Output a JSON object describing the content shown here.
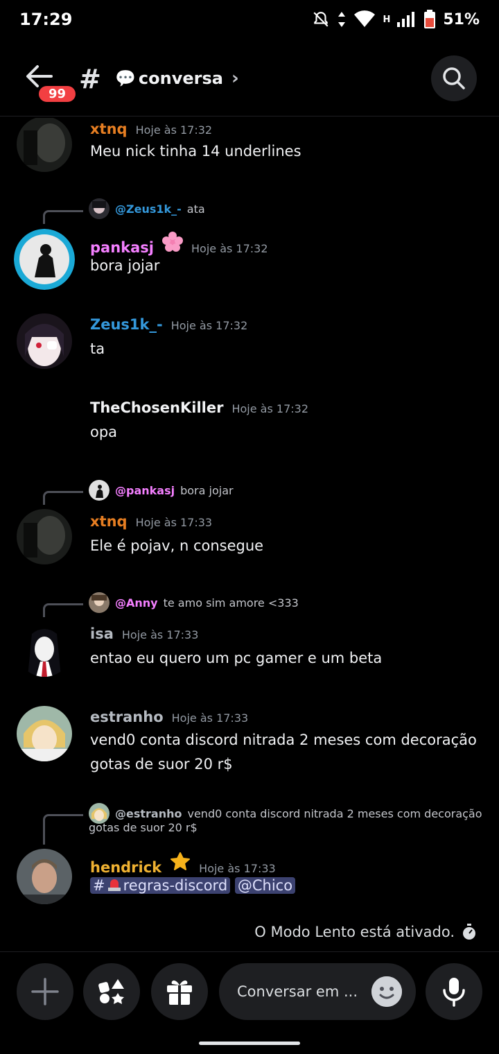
{
  "status_bar": {
    "time": "17:29",
    "network": "H",
    "battery": "51%"
  },
  "header": {
    "badge_count": "99",
    "channel_emoji": "💬",
    "channel_name": "conversa",
    "chevron": "›",
    "icons": [
      "back-arrow-icon",
      "hash-icon",
      "search-icon"
    ]
  },
  "colors": {
    "background": "#000000",
    "orange": "#e67e22",
    "pink": "#f47fff",
    "blue": "#3498db",
    "gold": "#f0b232",
    "gray_name": "#b5bac1",
    "mention_bg": "#3c4270"
  },
  "messages": [
    {
      "author": "xtnq",
      "time": "Hoje às 17:32",
      "text": "Meu nick tinha 14 underlines"
    },
    {
      "reply_to": "@Zeus1k_-",
      "reply_text": "ata",
      "author": "pankasj",
      "time": "Hoje às 17:32",
      "text": "bora jojar"
    },
    {
      "author": "Zeus1k_-",
      "time": "Hoje às 17:32",
      "text": "ta"
    },
    {
      "author": "TheChosenKiller",
      "time": "Hoje às 17:32",
      "text": "opa"
    },
    {
      "reply_to": "@pankasj",
      "reply_text": "bora jojar",
      "author": "xtnq",
      "time": "Hoje às 17:33",
      "text": "Ele é pojav, n consegue"
    },
    {
      "reply_to": "@Anny",
      "reply_text": "te amo sim amore <333",
      "author": "isa",
      "time": "Hoje às 17:33",
      "text": "entao eu quero um pc gamer e um beta"
    },
    {
      "author": "estranho",
      "time": "Hoje às 17:33",
      "text_line1": "vend0 conta discord nitrada 2 meses com decoração",
      "text_line2": "gotas de suor 20 r$"
    },
    {
      "reply_to": "@estranho",
      "reply_text_line1": "vend0 conta discord nitrada 2 meses com decoração",
      "reply_text_line2": "gotas de suor 20 r$",
      "author": "hendrick",
      "time": "Hoje às 17:33",
      "channel_mention_hash": "#",
      "channel_mention": "regras-discord",
      "user_mention": "@Chico"
    }
  ],
  "slowmode_text": "O Modo Lento está ativado.",
  "composer": {
    "placeholder": "Conversar em ...",
    "icons": [
      "plus-icon",
      "apps-icon",
      "gift-icon",
      "emoji-icon",
      "microphone-icon"
    ]
  }
}
